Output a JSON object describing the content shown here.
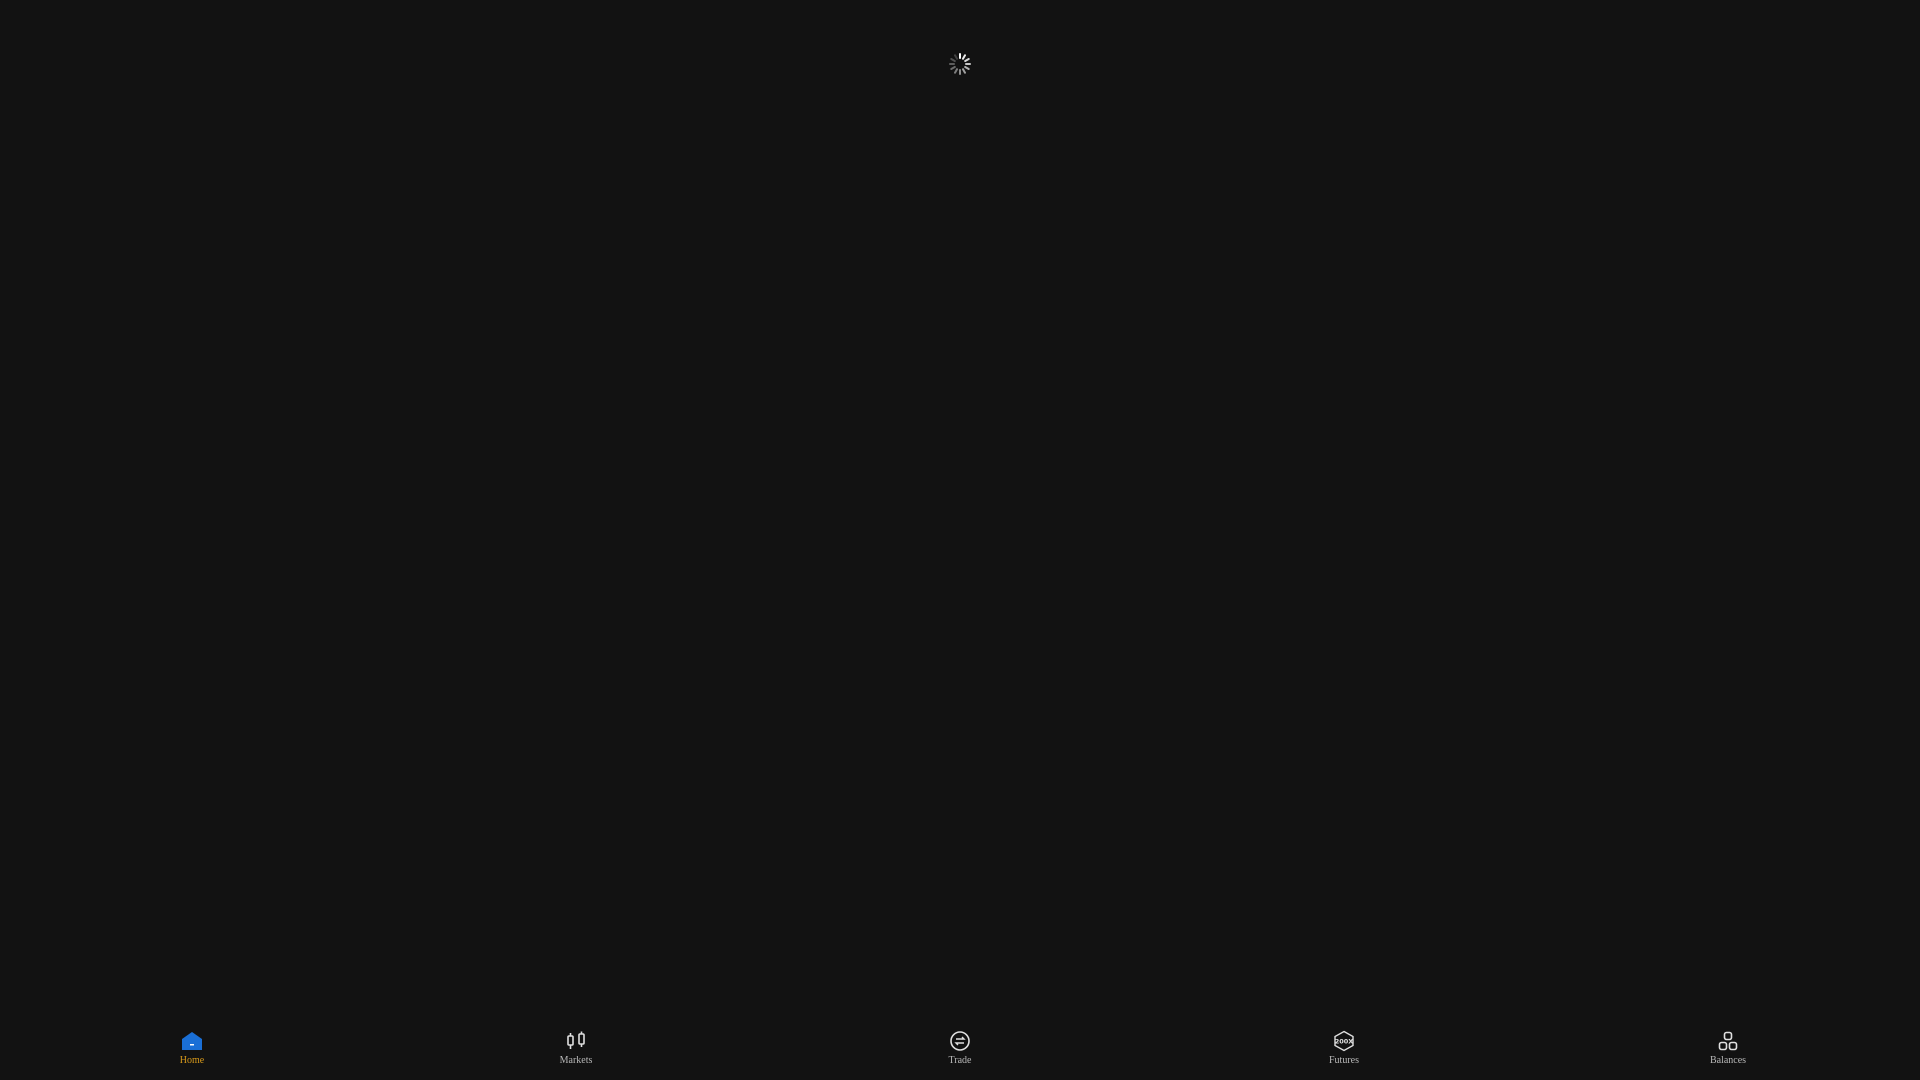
{
  "nav": {
    "items": [
      {
        "label": "Home",
        "icon": "home-icon",
        "active": true
      },
      {
        "label": "Markets",
        "icon": "candlestick-icon",
        "active": false
      },
      {
        "label": "Trade",
        "icon": "swap-arrows-icon",
        "active": false
      },
      {
        "label": "Futures",
        "icon": "futures-200x-icon",
        "active": false
      },
      {
        "label": "Balances",
        "icon": "balances-blocks-icon",
        "active": false
      }
    ]
  },
  "colors": {
    "background": "#121212",
    "active_label": "#d89a1a",
    "active_icon": "#1a6fd6",
    "inactive": "#b8b8b8"
  }
}
